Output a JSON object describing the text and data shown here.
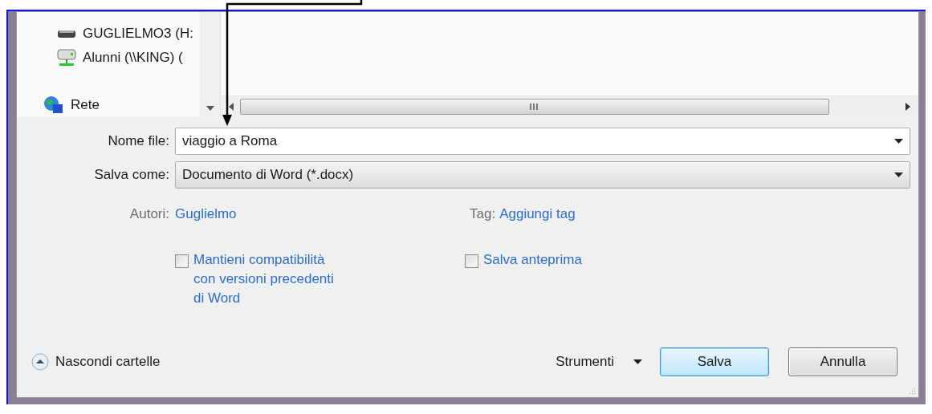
{
  "navigation": {
    "items": [
      {
        "kind": "drive",
        "label": "GUGLIELMO3 (H:"
      },
      {
        "kind": "network-drive",
        "label": "Alunni (\\\\KING) ("
      },
      {
        "kind": "network",
        "label": "Rete"
      }
    ]
  },
  "file_name": {
    "label": "Nome file:",
    "value": "viaggio a Roma"
  },
  "save_as": {
    "label": "Salva come:",
    "value": "Documento di Word (*.docx)"
  },
  "authors": {
    "label": "Autori:",
    "value": "Guglielmo"
  },
  "tags": {
    "label": "Tag:",
    "value": "Aggiungi tag"
  },
  "options": [
    {
      "label": "Mantieni compatibilità con versioni precedenti di Word",
      "checked": false
    },
    {
      "label": "Salva anteprima",
      "checked": false
    }
  ],
  "hide_folders": {
    "label": "Nascondi cartelle"
  },
  "tools": {
    "label": "Strumenti"
  },
  "buttons": [
    {
      "label": "Salva",
      "default": true
    },
    {
      "label": "Annulla",
      "default": false
    }
  ]
}
